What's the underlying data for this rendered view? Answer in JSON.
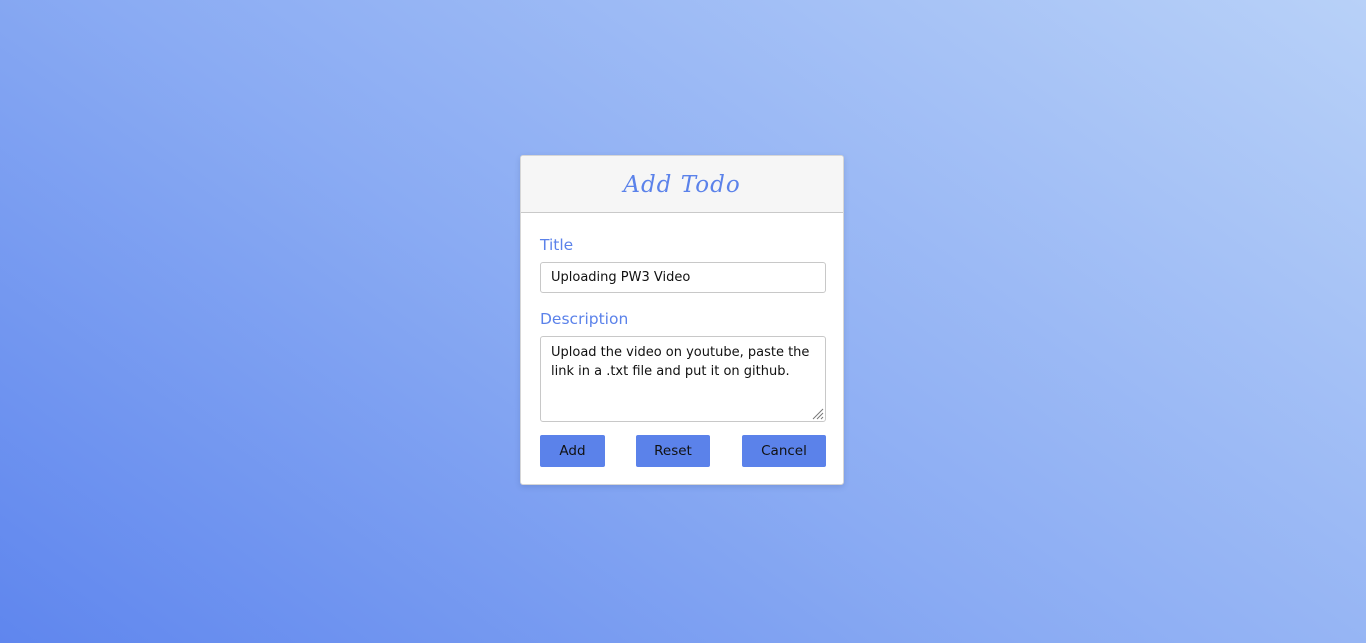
{
  "form": {
    "title": "Add Todo",
    "title_label": "Title",
    "title_value": "Uploading PW3 Video",
    "description_label": "Description",
    "description_value": "Upload the video on youtube, paste the link in a .txt file and put it on github."
  },
  "buttons": {
    "add_label": "Add",
    "reset_label": "Reset",
    "cancel_label": "Cancel"
  },
  "colors": {
    "accent": "#5b82ea",
    "header_bg": "#f6f6f6",
    "background_start": "#5f86ee",
    "background_end": "#b8d1f8"
  },
  "icons": {
    "textarea_resize": "resize-grip-icon"
  }
}
